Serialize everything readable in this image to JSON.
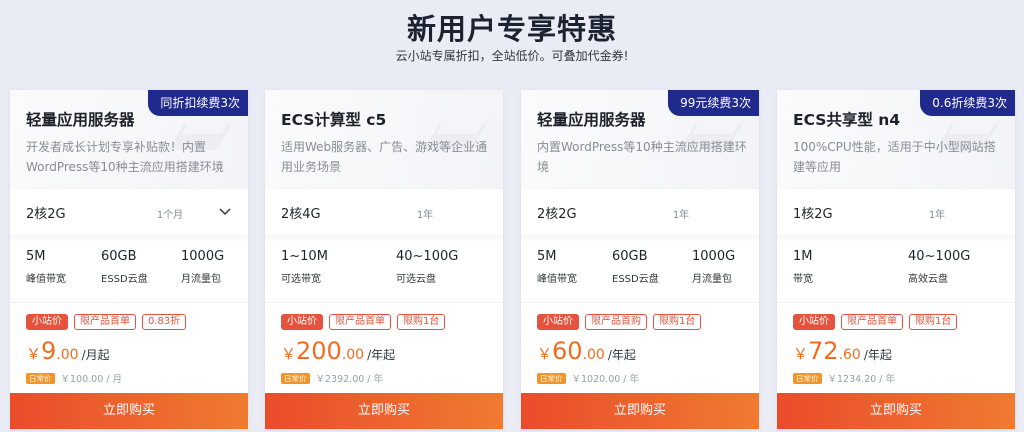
{
  "hero": {
    "title": "新用户专享特惠",
    "subtitle": "云小站专属折扣，全站低价。可叠加代金券!"
  },
  "colors": {
    "page_bg": "#e9ebf5",
    "tag_bg": "#202a8c",
    "price": "#f46c1f",
    "badge": "#e5533d",
    "buy_from": "#ea4c2c",
    "buy_to": "#f07a30"
  },
  "cards": [
    {
      "corner_tag": "同折扣续费3次",
      "title": "轻量应用服务器",
      "desc": "开发者成长计划专享补贴款！内置WordPress等10种主流应用搭建环境",
      "spec": "2核2G",
      "period": "1个月",
      "dropdown_icon": "chevron-down-icon",
      "metrics": [
        {
          "value": "5M",
          "label": "峰值带宽"
        },
        {
          "value": "60GB",
          "label": "ESSD云盘"
        },
        {
          "value": "1000G",
          "label": "月流量包"
        }
      ],
      "badges": [
        "小站价",
        "限产品首单",
        "0.83折"
      ],
      "price": {
        "currency": "￥",
        "int": "9",
        "dec": ".00",
        "unit": "/月起"
      },
      "orig_tag": "日常价",
      "orig_price": "￥100.00 / 月",
      "buy": "立即购买"
    },
    {
      "corner_tag": "",
      "title": "ECS计算型 c5",
      "desc": "适用Web服务器、广告、游戏等企业通用业务场景",
      "spec": "2核4G",
      "period": "1年",
      "metrics": [
        {
          "value": "1~10M",
          "label": "可选带宽"
        },
        {
          "value": "40~100G",
          "label": "可选云盘"
        }
      ],
      "badges": [
        "小站价",
        "限产品首单",
        "限购1台"
      ],
      "price": {
        "currency": "￥",
        "int": "200",
        "dec": ".00",
        "unit": "/年起"
      },
      "orig_tag": "日常价",
      "orig_price": "￥2392.00 / 年",
      "buy": "立即购买"
    },
    {
      "corner_tag": "99元续费3次",
      "title": "轻量应用服务器",
      "desc": "内置WordPress等10种主流应用搭建环境",
      "spec": "2核2G",
      "period": "1年",
      "metrics": [
        {
          "value": "5M",
          "label": "峰值带宽"
        },
        {
          "value": "60GB",
          "label": "ESSD云盘"
        },
        {
          "value": "1000G",
          "label": "月流量包"
        }
      ],
      "badges": [
        "小站价",
        "限产品首购",
        "限购1台"
      ],
      "price": {
        "currency": "￥",
        "int": "60",
        "dec": ".00",
        "unit": "/年起"
      },
      "orig_tag": "日常价",
      "orig_price": "￥1020.00 / 年",
      "buy": "立即购买"
    },
    {
      "corner_tag": "0.6折续费3次",
      "title": "ECS共享型 n4",
      "desc": "100%CPU性能，适用于中小型网站搭建等应用",
      "spec": "1核2G",
      "period": "1年",
      "metrics": [
        {
          "value": "1M",
          "label": "带宽"
        },
        {
          "value": "40~100G",
          "label": "高效云盘"
        }
      ],
      "badges": [
        "小站价",
        "限产品首单",
        "限购1台"
      ],
      "price": {
        "currency": "￥",
        "int": "72",
        "dec": ".60",
        "unit": "/年起"
      },
      "orig_tag": "日常价",
      "orig_price": "￥1234.20 / 年",
      "buy": "立即购买"
    }
  ]
}
